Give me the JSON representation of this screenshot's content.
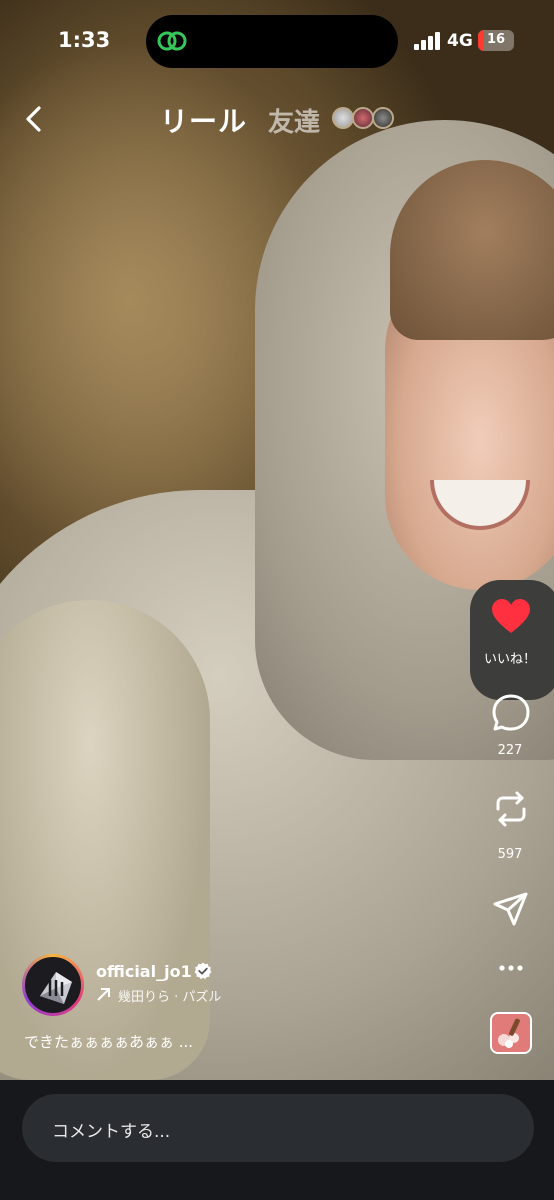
{
  "status_bar": {
    "time": "1:33",
    "network": "4G",
    "battery_level": "16",
    "battery_fraction": 0.16
  },
  "header": {
    "back_icon": "chevron-left-icon",
    "tab_reels": "リール",
    "tab_friends": "友達"
  },
  "actions": {
    "like_label": "いいね！",
    "comment_count": "227",
    "repost_count": "597",
    "like_color": "#ff3040"
  },
  "post": {
    "username": "official_jo1",
    "music": "幾田りら · パズル",
    "caption": "できたぁぁぁぁあぁぁ ..."
  },
  "comment": {
    "placeholder": "コメントする..."
  }
}
